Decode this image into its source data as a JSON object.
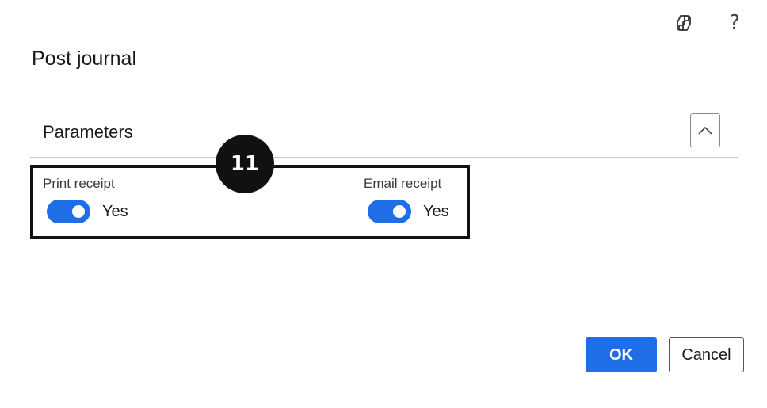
{
  "top_icons": [
    "copilot-icon",
    "help-icon"
  ],
  "help_glyph": "?",
  "dialog": {
    "title": "Post journal"
  },
  "section": {
    "title": "Parameters",
    "collapse_icon": "chevron-up-icon"
  },
  "fields": {
    "print_receipt": {
      "label": "Print receipt",
      "value": "Yes",
      "on": true
    },
    "email_receipt": {
      "label": "Email receipt",
      "value": "Yes",
      "on": true
    }
  },
  "step_badge": "11",
  "buttons": {
    "ok": "OK",
    "cancel": "Cancel"
  },
  "colors": {
    "accent": "#1f6ee8",
    "highlight_border": "#111111"
  }
}
